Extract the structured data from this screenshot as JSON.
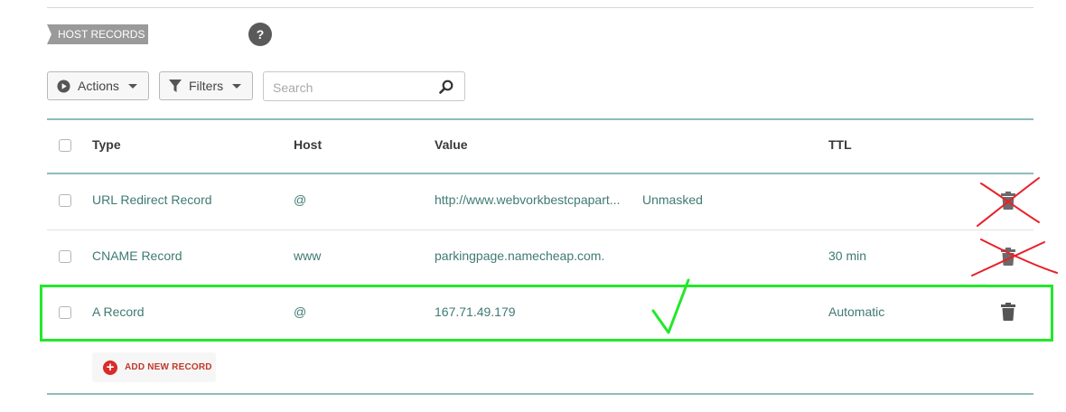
{
  "section": {
    "title": "HOST RECORDS",
    "help_glyph": "?"
  },
  "toolbar": {
    "actions_label": "Actions",
    "filters_label": "Filters",
    "search_placeholder": "Search"
  },
  "table": {
    "headers": {
      "type": "Type",
      "host": "Host",
      "value": "Value",
      "ttl": "TTL"
    },
    "rows": [
      {
        "type": "URL Redirect Record",
        "host": "@",
        "value": "http://www.webvorkbestcpapart...",
        "extra": "Unmasked",
        "ttl": "",
        "mark": "red-x"
      },
      {
        "type": "CNAME Record",
        "host": "www",
        "value": "parkingpage.namecheap.com.",
        "extra": "",
        "ttl": "30 min",
        "mark": "red-x"
      },
      {
        "type": "A Record",
        "host": "@",
        "value": "167.71.49.179",
        "extra": "",
        "ttl": "Automatic",
        "mark": "green-check"
      }
    ]
  },
  "add_record": {
    "label": "ADD NEW RECORD"
  },
  "colors": {
    "teal": "#8fbcbc",
    "link_text": "#3f7a74",
    "annotation_red": "#e8202a",
    "annotation_green": "#22e82a",
    "add_red": "#d92b2b"
  },
  "icons": [
    "play-circle-icon",
    "filter-funnel-icon",
    "search-magnifier-icon",
    "trash-icon",
    "plus-circle-icon",
    "help-question-icon"
  ]
}
